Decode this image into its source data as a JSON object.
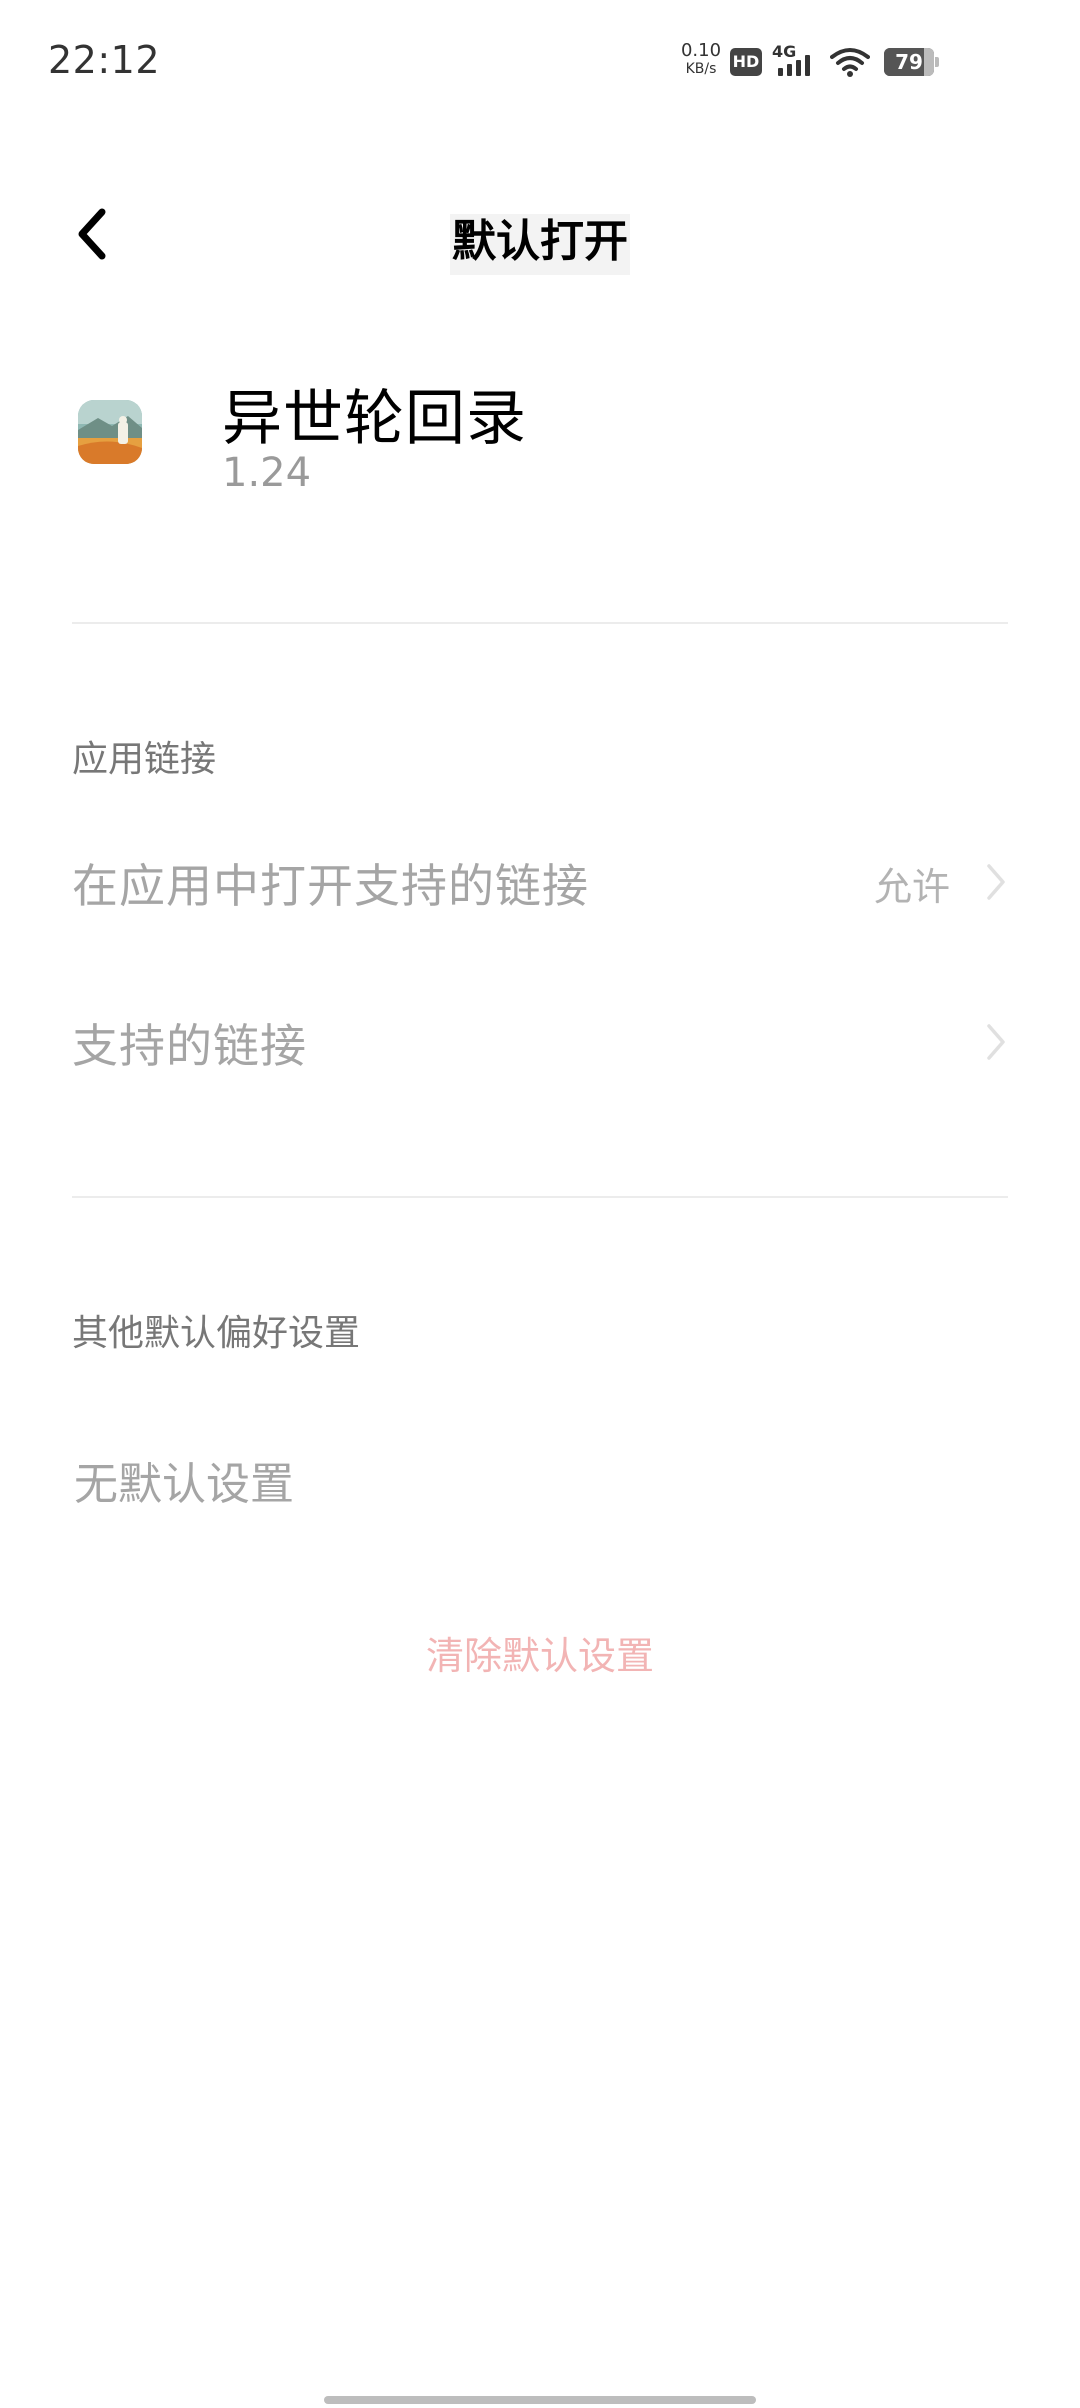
{
  "status_bar": {
    "time": "22:12",
    "net_speed_value": "0.10",
    "net_speed_unit": "KB/s",
    "hd_label": "HD",
    "network_type": "4G",
    "battery_level": "79"
  },
  "header": {
    "title": "默认打开"
  },
  "app": {
    "name": "异世轮回录",
    "version": "1.24"
  },
  "app_links": {
    "section_title": "应用链接",
    "open_supported_links_label": "在应用中打开支持的链接",
    "open_supported_links_value": "允许",
    "supported_links_label": "支持的链接"
  },
  "other_defaults": {
    "section_title": "其他默认偏好设置",
    "none_text": "无默认设置",
    "clear_button_label": "清除默认设置"
  },
  "colors": {
    "accent_clear": "#f2b4b4",
    "disabled_text": "#a5a5a5"
  }
}
